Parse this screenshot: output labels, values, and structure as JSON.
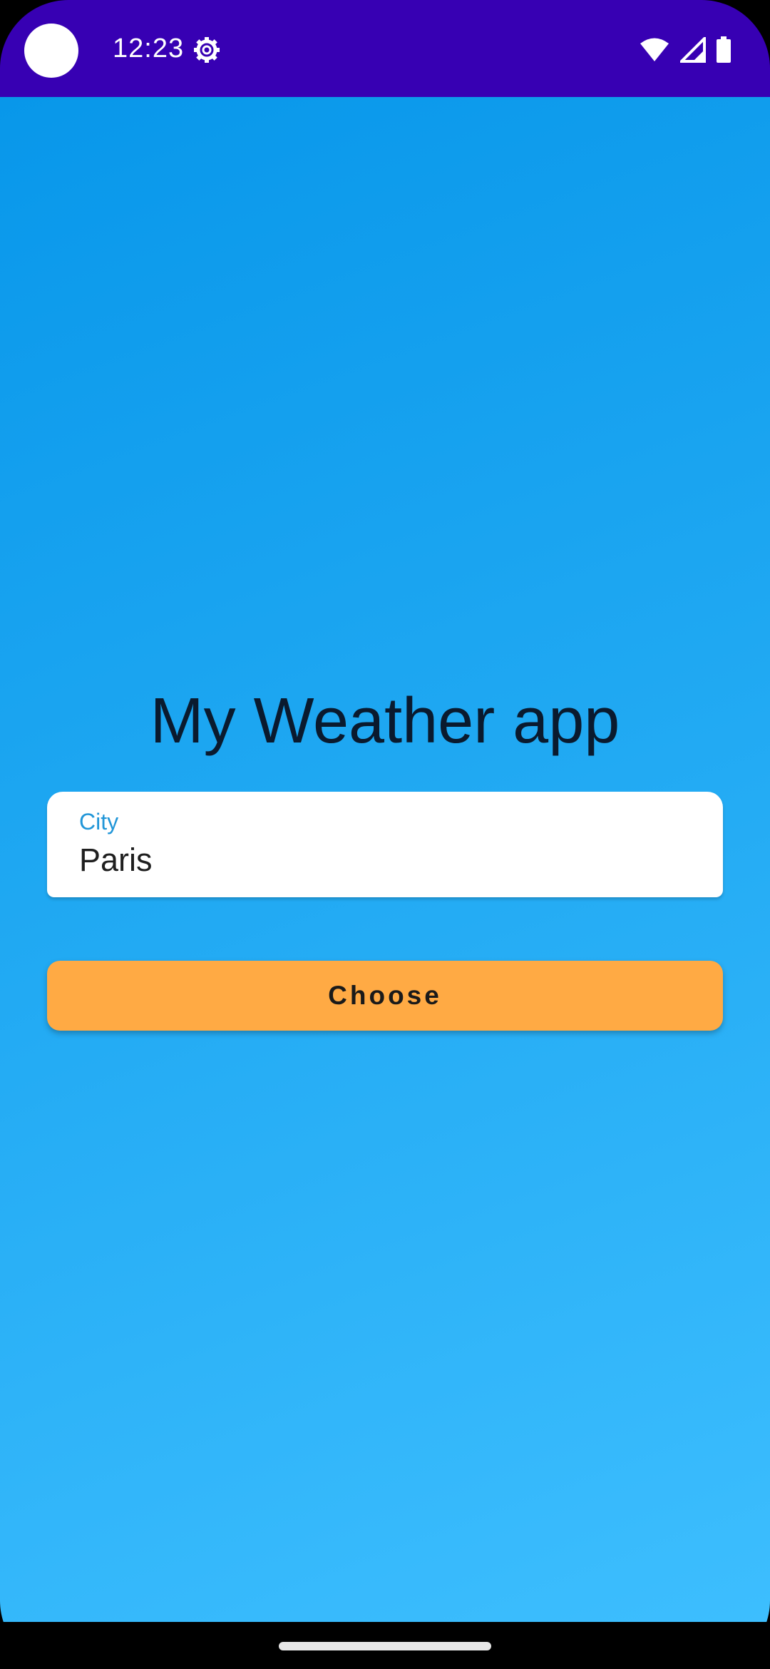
{
  "status_bar": {
    "time": "12:23",
    "background_color": "#3700b3",
    "icons": [
      "settings-gear-icon",
      "wifi-icon",
      "cellular-signal-icon",
      "battery-icon"
    ]
  },
  "main": {
    "title": "My Weather app",
    "city_field": {
      "label": "City",
      "value": "Paris"
    },
    "choose_button": {
      "label": "Choose",
      "color": "#ffaa44"
    },
    "background_gradient": [
      "#0897ea",
      "#3dbefe"
    ]
  }
}
